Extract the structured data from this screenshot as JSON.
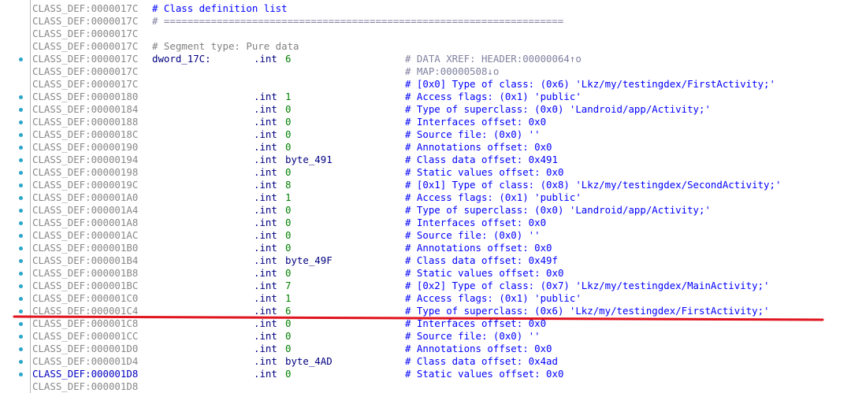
{
  "colors": {
    "address": "#888888",
    "current_address": "#0000c0",
    "mnemonic": "#000080",
    "number_operand": "#008000",
    "comment": "#0000ff",
    "xref_comment": "#8080a0",
    "breakpoint_dot": "#2aa6c8",
    "annotation_line": "#e0141e"
  },
  "rows": [
    {
      "addr": "CLASS_DEF:0000017C",
      "seg": "# Class definition list",
      "seg_style": "title"
    },
    {
      "addr": "CLASS_DEF:0000017C",
      "seg": "# ====================================================================",
      "seg_style": "sep"
    },
    {
      "addr": "CLASS_DEF:0000017C"
    },
    {
      "addr": "CLASS_DEF:0000017C",
      "seg": "# Segment type: Pure data",
      "seg_style": "plain"
    },
    {
      "addr": "CLASS_DEF:0000017C",
      "bp": true,
      "label": "dword_17C:",
      "mnem": ".int",
      "oper": "6",
      "comment": "# DATA XREF: HEADER:00000064↑o",
      "comment_style": "xref"
    },
    {
      "addr": "CLASS_DEF:0000017C",
      "comment": "# MAP:00000508↓o",
      "comment_style": "xref"
    },
    {
      "addr": "CLASS_DEF:0000017C",
      "comment": "# [0x0] Type of class: (0x6) 'Lkz/my/testingdex/FirstActivity;'"
    },
    {
      "addr": "CLASS_DEF:00000180",
      "bp": true,
      "mnem": ".int",
      "oper": "1",
      "comment": "# Access flags: (0x1) 'public'"
    },
    {
      "addr": "CLASS_DEF:00000184",
      "bp": true,
      "mnem": ".int",
      "oper": "0",
      "comment": "# Type of superclass: (0x0) 'Landroid/app/Activity;'"
    },
    {
      "addr": "CLASS_DEF:00000188",
      "bp": true,
      "mnem": ".int",
      "oper": "0",
      "comment": "# Interfaces offset: 0x0"
    },
    {
      "addr": "CLASS_DEF:0000018C",
      "bp": true,
      "mnem": ".int",
      "oper": "0",
      "comment": "# Source file: (0x0) ''"
    },
    {
      "addr": "CLASS_DEF:00000190",
      "bp": true,
      "mnem": ".int",
      "oper": "0",
      "comment": "# Annotations offset: 0x0"
    },
    {
      "addr": "CLASS_DEF:00000194",
      "bp": true,
      "mnem": ".int",
      "oper": "byte_491",
      "oper_style": "sym",
      "comment": "# Class data offset: 0x491"
    },
    {
      "addr": "CLASS_DEF:00000198",
      "bp": true,
      "mnem": ".int",
      "oper": "0",
      "comment": "# Static values offset: 0x0"
    },
    {
      "addr": "CLASS_DEF:0000019C",
      "bp": true,
      "mnem": ".int",
      "oper": "8",
      "comment": "# [0x1] Type of class: (0x8) 'Lkz/my/testingdex/SecondActivity;'"
    },
    {
      "addr": "CLASS_DEF:000001A0",
      "bp": true,
      "mnem": ".int",
      "oper": "1",
      "comment": "# Access flags: (0x1) 'public'"
    },
    {
      "addr": "CLASS_DEF:000001A4",
      "bp": true,
      "mnem": ".int",
      "oper": "0",
      "comment": "# Type of superclass: (0x0) 'Landroid/app/Activity;'"
    },
    {
      "addr": "CLASS_DEF:000001A8",
      "bp": true,
      "mnem": ".int",
      "oper": "0",
      "comment": "# Interfaces offset: 0x0"
    },
    {
      "addr": "CLASS_DEF:000001AC",
      "bp": true,
      "mnem": ".int",
      "oper": "0",
      "comment": "# Source file: (0x0) ''"
    },
    {
      "addr": "CLASS_DEF:000001B0",
      "bp": true,
      "mnem": ".int",
      "oper": "0",
      "comment": "# Annotations offset: 0x0"
    },
    {
      "addr": "CLASS_DEF:000001B4",
      "bp": true,
      "mnem": ".int",
      "oper": "byte_49F",
      "oper_style": "sym",
      "comment": "# Class data offset: 0x49f"
    },
    {
      "addr": "CLASS_DEF:000001B8",
      "bp": true,
      "mnem": ".int",
      "oper": "0",
      "comment": "# Static values offset: 0x0"
    },
    {
      "addr": "CLASS_DEF:000001BC",
      "bp": true,
      "mnem": ".int",
      "oper": "7",
      "comment": "# [0x2] Type of class: (0x7) 'Lkz/my/testingdex/MainActivity;'"
    },
    {
      "addr": "CLASS_DEF:000001C0",
      "bp": true,
      "mnem": ".int",
      "oper": "1",
      "comment": "# Access flags: (0x1) 'public'"
    },
    {
      "addr": "CLASS_DEF:000001C4",
      "bp": true,
      "mnem": ".int",
      "oper": "6",
      "comment": "# Type of superclass: (0x6) 'Lkz/my/testingdex/FirstActivity;'"
    },
    {
      "addr": "CLASS_DEF:000001C8",
      "bp": true,
      "mnem": ".int",
      "oper": "0",
      "comment": "# Interfaces offset: 0x0"
    },
    {
      "addr": "CLASS_DEF:000001CC",
      "bp": true,
      "mnem": ".int",
      "oper": "0",
      "comment": "# Source file: (0x0) ''"
    },
    {
      "addr": "CLASS_DEF:000001D0",
      "bp": true,
      "mnem": ".int",
      "oper": "0",
      "comment": "# Annotations offset: 0x0"
    },
    {
      "addr": "CLASS_DEF:000001D4",
      "bp": true,
      "mnem": ".int",
      "oper": "byte_4AD",
      "oper_style": "sym",
      "comment": "# Class data offset: 0x4ad"
    },
    {
      "addr": "CLASS_DEF:000001D8",
      "bp": true,
      "current": true,
      "mnem": ".int",
      "oper": "0",
      "comment": "# Static values offset: 0x0"
    },
    {
      "addr": "CLASS_DEF:000001D8"
    }
  ]
}
